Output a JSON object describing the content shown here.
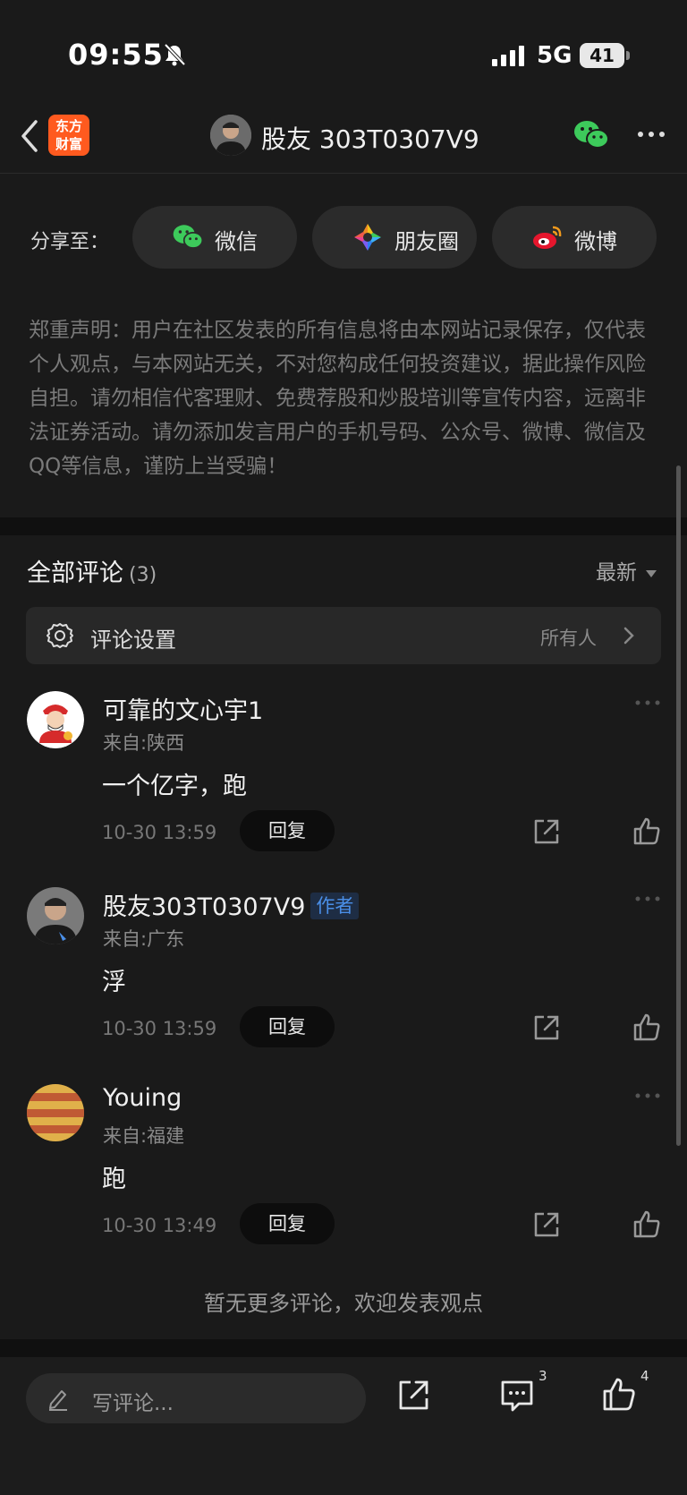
{
  "status": {
    "time": "09:55",
    "network": "5G",
    "battery": "41"
  },
  "nav": {
    "logo_line1": "东方",
    "logo_line2": "财富",
    "title": "股友 303T0307V9"
  },
  "share": {
    "label": "分享至：",
    "buttons": [
      {
        "label": "微信",
        "icon": "wechat-icon"
      },
      {
        "label": "朋友圈",
        "icon": "moments-icon"
      },
      {
        "label": "微博",
        "icon": "weibo-icon"
      }
    ]
  },
  "disclaimer": "郑重声明：用户在社区发表的所有信息将由本网站记录保存，仅代表个人观点，与本网站无关，不对您构成任何投资建议，据此操作风险自担。请勿相信代客理财、免费荐股和炒股培训等宣传内容，远离非法证券活动。请勿添加发言用户的手机号码、公众号、微博、微信及QQ等信息，谨防上当受骗！",
  "comments_section": {
    "title": "全部评论",
    "count": "(3)",
    "sort_label": "最新",
    "settings_label": "评论设置",
    "settings_value": "所有人"
  },
  "comments": [
    {
      "name": "可靠的文心宇1",
      "author_tag": "",
      "origin": "来自:陕西",
      "text": "一个亿字，跑",
      "time": "10-30 13:59",
      "reply": "回复"
    },
    {
      "name": "股友303T0307V9",
      "author_tag": "作者",
      "origin": "来自:广东",
      "text": "浮",
      "time": "10-30 13:59",
      "reply": "回复"
    },
    {
      "name": "Youing",
      "author_tag": "",
      "origin": "来自:福建",
      "text": "跑",
      "time": "10-30 13:49",
      "reply": "回复"
    }
  ],
  "no_more": "暂无更多评论，欢迎发表观点",
  "bottom_bar": {
    "write_placeholder": "写评论...",
    "comment_count": "3",
    "like_count": "4"
  },
  "colors": {
    "background": "#1a1a1a",
    "brand_orange": "#ff5a1f",
    "author_tag_blue": "#4a8fe8",
    "wechat_green": "#3dca5b"
  }
}
